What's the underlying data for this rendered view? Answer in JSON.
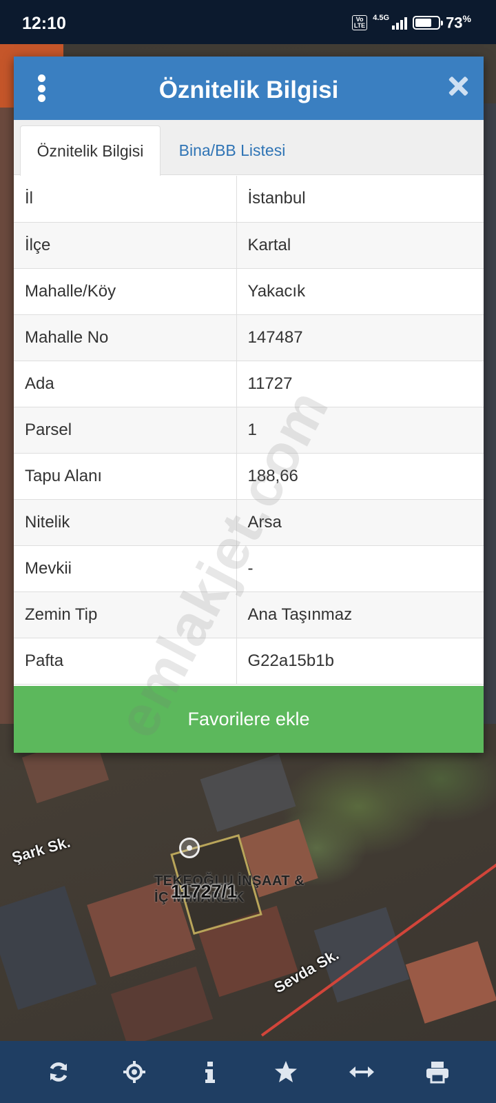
{
  "status_bar": {
    "time": "12:10",
    "network": "4.5G",
    "volte": "Vo LTE",
    "battery_percent": "73",
    "battery_percent_sign": "%",
    "battery_level": 0.73
  },
  "dialog": {
    "title": "Öznitelik Bilgisi",
    "menu_icon": "kebab-menu-icon",
    "close_icon": "close-icon",
    "tabs": [
      {
        "label": "Öznitelik Bilgisi",
        "active": true
      },
      {
        "label": "Bina/BB Listesi",
        "active": false
      }
    ],
    "rows": [
      {
        "key": "İl",
        "value": "İstanbul"
      },
      {
        "key": "İlçe",
        "value": "Kartal"
      },
      {
        "key": "Mahalle/Köy",
        "value": "Yakacık"
      },
      {
        "key": "Mahalle No",
        "value": "147487"
      },
      {
        "key": "Ada",
        "value": "11727"
      },
      {
        "key": "Parsel",
        "value": "1"
      },
      {
        "key": "Tapu Alanı",
        "value": "188,66"
      },
      {
        "key": "Nitelik",
        "value": "Arsa"
      },
      {
        "key": "Mevkii",
        "value": "-"
      },
      {
        "key": "Zemin Tip",
        "value": "Ana Taşınmaz"
      },
      {
        "key": "Pafta",
        "value": "G22a15b1b"
      }
    ],
    "favorite_button": "Favorilere ekle"
  },
  "watermark": "emlakjet.com",
  "map": {
    "streets": [
      "Şark Sk.",
      "Sevda Sk."
    ],
    "parcel_label": "11727/1",
    "business_label": "TEKEOĞLU İNŞAAT & İÇ MİMARLIK"
  },
  "toolbar": {
    "items": [
      {
        "icon": "refresh-icon"
      },
      {
        "icon": "locate-icon"
      },
      {
        "icon": "info-icon"
      },
      {
        "icon": "star-icon"
      },
      {
        "icon": "measure-icon"
      },
      {
        "icon": "print-icon"
      }
    ]
  },
  "colors": {
    "header_blue": "#3a7fc1",
    "tab_link_blue": "#2f74b5",
    "button_green": "#5cb85c",
    "toolbar_navy": "#1f3e63"
  }
}
